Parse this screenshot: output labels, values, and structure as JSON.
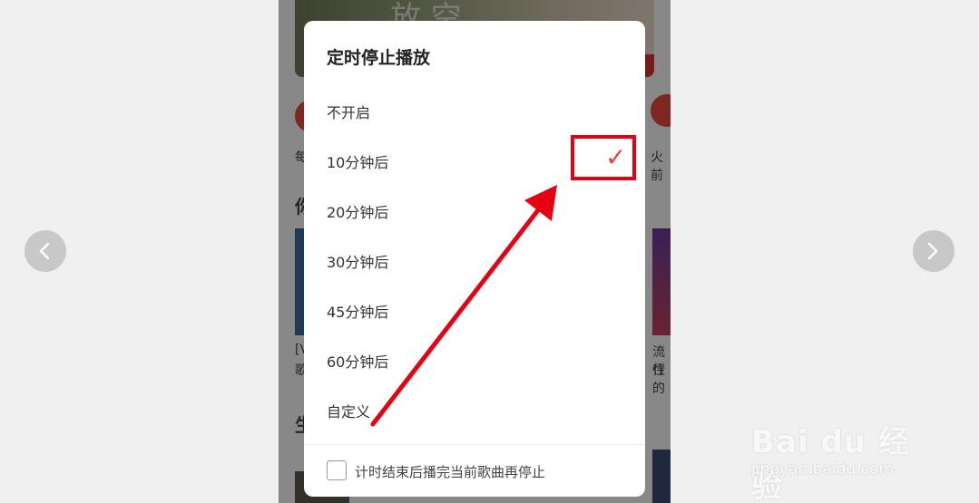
{
  "dialog": {
    "title": "定时停止播放",
    "options": [
      {
        "label": "不开启",
        "selected": false
      },
      {
        "label": "10分钟后",
        "selected": true
      },
      {
        "label": "20分钟后",
        "selected": false
      },
      {
        "label": "30分钟后",
        "selected": false
      },
      {
        "label": "45分钟后",
        "selected": false
      },
      {
        "label": "60分钟后",
        "selected": false
      },
      {
        "label": "自定义",
        "selected": false
      }
    ],
    "checkmark": "✓",
    "footer_checkbox": {
      "label": "计时结束后播完当前歌曲再停止",
      "checked": false
    }
  },
  "background": {
    "banner_text": "放 空",
    "left_texts": [
      "每",
      "你",
      "[V",
      "歌",
      "生"
    ],
    "right_texts": [
      "火前",
      "流行",
      "住的"
    ]
  },
  "watermark": {
    "logo": "Bai du 经验",
    "url": "jingyan.baidu.com"
  },
  "colors": {
    "accent": "#e64340",
    "annotation": "#e60012"
  },
  "icons": {
    "prev": "chevron-left-icon",
    "next": "chevron-right-icon",
    "check": "checkmark-icon"
  }
}
